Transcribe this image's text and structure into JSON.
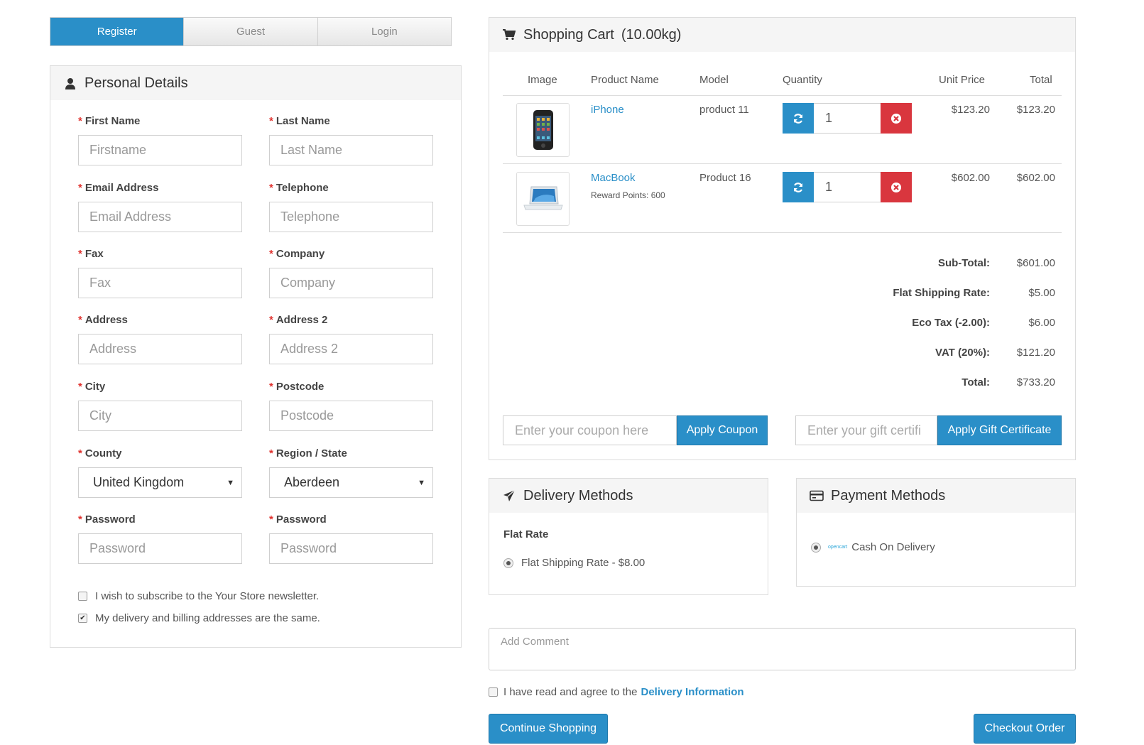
{
  "tabs": [
    "Register",
    "Guest",
    "Login"
  ],
  "personal": {
    "title": "Personal Details",
    "fields": [
      {
        "label": "First Name",
        "placeholder": "Firstname"
      },
      {
        "label": "Last Name",
        "placeholder": "Last Name"
      },
      {
        "label": "Email Address",
        "placeholder": "Email Address"
      },
      {
        "label": "Telephone",
        "placeholder": "Telephone"
      },
      {
        "label": "Fax",
        "placeholder": "Fax"
      },
      {
        "label": "Company",
        "placeholder": "Company"
      },
      {
        "label": "Address",
        "placeholder": "Address"
      },
      {
        "label": "Address 2",
        "placeholder": "Address 2"
      },
      {
        "label": "City",
        "placeholder": "City"
      },
      {
        "label": "Postcode",
        "placeholder": "Postcode"
      },
      {
        "label": "County",
        "value": "United Kingdom"
      },
      {
        "label": "Region / State",
        "value": "Aberdeen"
      },
      {
        "label": "Password",
        "placeholder": "Password"
      },
      {
        "label": "Password",
        "placeholder": "Password"
      }
    ],
    "required_mark": "*",
    "newsletter": "I wish to subscribe to the Your Store newsletter.",
    "same_address": "My delivery and billing addresses are the same."
  },
  "cart": {
    "title": "Shopping Cart",
    "weight": "(10.00kg)",
    "headers": {
      "image": "Image",
      "name": "Product Name",
      "model": "Model",
      "quantity": "Quantity",
      "unit": "Unit Price",
      "total": "Total"
    },
    "items": [
      {
        "name": "iPhone",
        "model": "product 11",
        "qty": "1",
        "unit": "$123.20",
        "total": "$123.20",
        "reward": ""
      },
      {
        "name": "MacBook",
        "model": "Product 16",
        "qty": "1",
        "unit": "$602.00",
        "total": "$602.00",
        "reward": "Reward Points: 600"
      }
    ],
    "totals": [
      {
        "label": "Sub-Total:",
        "value": "$601.00"
      },
      {
        "label": "Flat Shipping Rate:",
        "value": "$5.00"
      },
      {
        "label": "Eco Tax (-2.00):",
        "value": "$6.00"
      },
      {
        "label": "VAT (20%):",
        "value": "$121.20"
      },
      {
        "label": "Total:",
        "value": "$733.20"
      }
    ],
    "coupon_placeholder": "Enter your coupon here",
    "coupon_button": "Apply Coupon",
    "gift_placeholder": "Enter your gift certifi",
    "gift_button": "Apply Gift Certificate"
  },
  "delivery": {
    "title": "Delivery Methods",
    "group": "Flat Rate",
    "option": "Flat Shipping Rate - $8.00"
  },
  "payment": {
    "title": "Payment Methods",
    "logo_text": "opencart",
    "option": "Cash On Delivery"
  },
  "comment_placeholder": "Add Comment",
  "agree_text": "I have read and agree to the",
  "agree_link": "Delivery Information",
  "continue_button": "Continue Shopping",
  "checkout_button": "Checkout Order",
  "colors": {
    "accent": "#2a8fc8",
    "danger": "#d9363e"
  }
}
